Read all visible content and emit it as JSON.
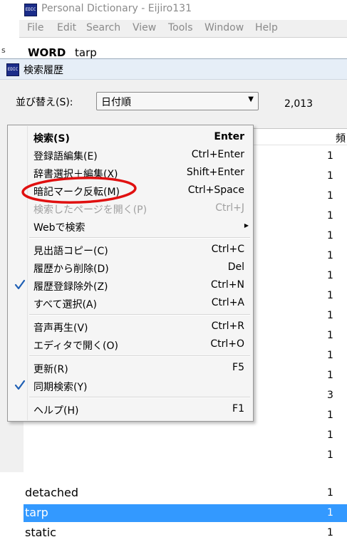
{
  "main_window": {
    "left_snippet": "s",
    "icon_text": "EDIC",
    "title": "Personal Dictionary - Eijiro131",
    "menu": [
      "File",
      "Edit",
      "Search",
      "View",
      "Tools",
      "Window",
      "Help"
    ],
    "word_label": "WORD",
    "word_value": "tarp"
  },
  "history_window": {
    "icon_text": "EDIC",
    "title": "検索履歴",
    "sort_label": "並び替え(S):",
    "sort_value": "日付順",
    "count": "2,013",
    "column_header_freq": "頻",
    "rows": [
      {
        "word": "",
        "count": "1"
      },
      {
        "word": "",
        "count": "1"
      },
      {
        "word": "",
        "count": "1"
      },
      {
        "word": "",
        "count": "1"
      },
      {
        "word": "",
        "count": "1"
      },
      {
        "word": "",
        "count": "1"
      },
      {
        "word": "",
        "count": "1"
      },
      {
        "word": "",
        "count": "1"
      },
      {
        "word": "",
        "count": "1"
      },
      {
        "word": "",
        "count": "1"
      },
      {
        "word": "",
        "count": "1"
      },
      {
        "word": "",
        "count": "1"
      },
      {
        "word": "",
        "count": "3"
      },
      {
        "word": "",
        "count": "1"
      },
      {
        "word": "",
        "count": "1"
      },
      {
        "word": "",
        "count": "1"
      },
      {
        "word": "detached",
        "count": "1"
      },
      {
        "word": "tarp",
        "count": "1"
      },
      {
        "word": "static",
        "count": "1"
      }
    ]
  },
  "context_menu": {
    "items": [
      {
        "label": "検索(S)",
        "shortcut": "Enter"
      },
      {
        "label": "登録語編集(E)",
        "shortcut": "Ctrl+Enter"
      },
      {
        "label": "辞書選択＋編集(X)",
        "shortcut": "Shift+Enter"
      },
      {
        "label": "暗記マーク反転(M)",
        "shortcut": "Ctrl+Space"
      },
      {
        "label": "検索したページを開く(P)",
        "shortcut": "Ctrl+J"
      },
      {
        "label": "Webで検索",
        "shortcut": ""
      },
      {
        "label": "見出語コピー(C)",
        "shortcut": "Ctrl+C"
      },
      {
        "label": "履歴から削除(D)",
        "shortcut": "Del"
      },
      {
        "label": "履歴登録除外(Z)",
        "shortcut": "Ctrl+N"
      },
      {
        "label": "すべて選択(A)",
        "shortcut": "Ctrl+A"
      },
      {
        "label": "音声再生(V)",
        "shortcut": "Ctrl+R"
      },
      {
        "label": "エディタで開く(O)",
        "shortcut": "Ctrl+O"
      },
      {
        "label": "更新(R)",
        "shortcut": "F5"
      },
      {
        "label": "同期検索(Y)",
        "shortcut": ""
      },
      {
        "label": "ヘルプ(H)",
        "shortcut": "F1"
      }
    ]
  },
  "colors": {
    "selection": "#3399ff",
    "annotation": "#e01010",
    "checkmark": "#1e5fb4"
  }
}
